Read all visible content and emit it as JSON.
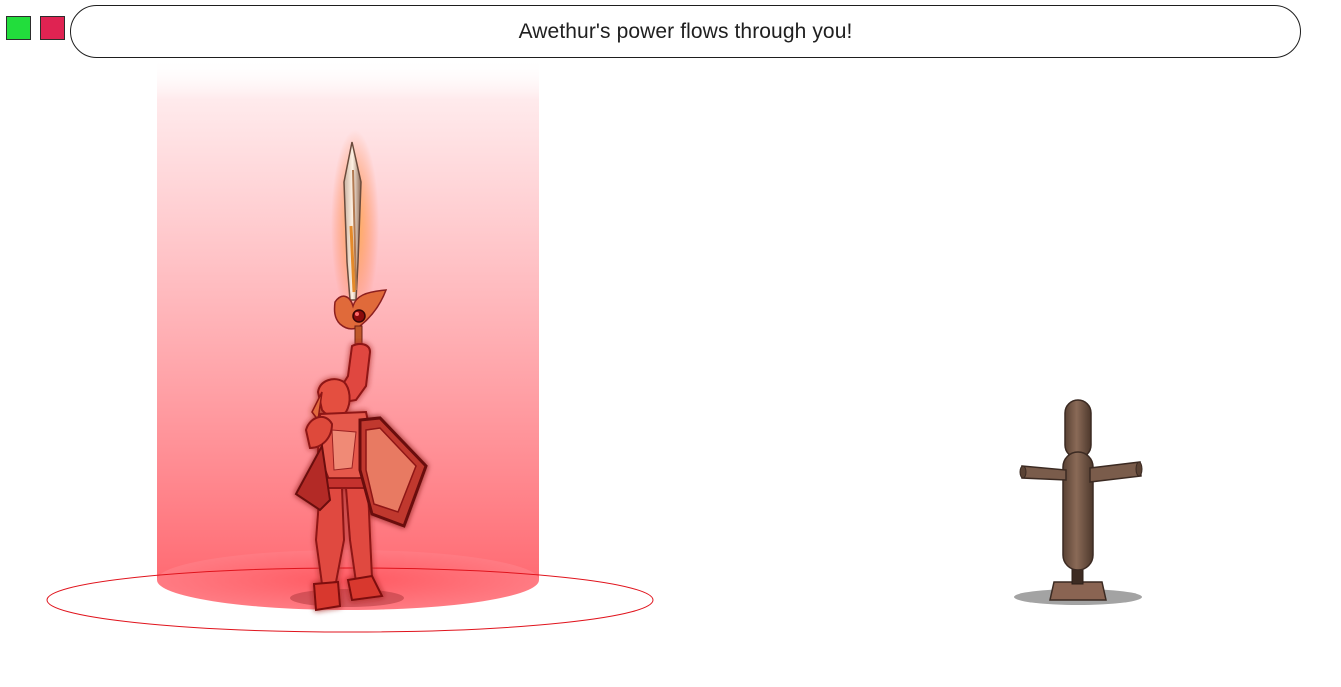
{
  "status_indicators": [
    {
      "name": "health",
      "color": "#22dd3c"
    },
    {
      "name": "mana",
      "color": "#df2352"
    }
  ],
  "message": {
    "text": "Awethur's power flows through you!"
  },
  "colors": {
    "aura": "#ff4f5d",
    "ring": "#e0131c",
    "hero_glow": "#ff1d1d",
    "dummy_wood": "#6e5445"
  },
  "scene": {
    "player": "armored-hero-with-sword",
    "effect": "red-light-pillar-aura",
    "target": "wooden-training-dummy"
  }
}
